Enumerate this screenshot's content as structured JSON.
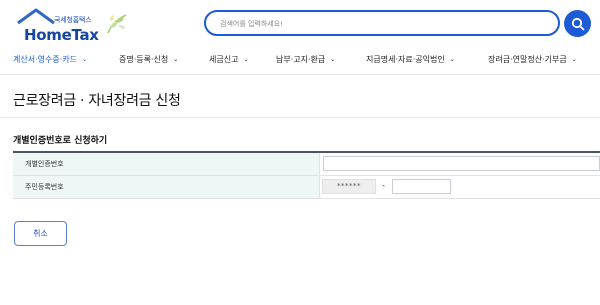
{
  "header": {
    "logo_sub": "국세청홈택스",
    "logo_main": "HomeTax",
    "search_placeholder": "검색어를 입력하세요!"
  },
  "nav": {
    "items": [
      {
        "label": "계산서·영수증·카드",
        "active": true
      },
      {
        "label": "증명·등록·신청",
        "active": false
      },
      {
        "label": "세금신고",
        "active": false
      },
      {
        "label": "납부·고지·환급",
        "active": false
      },
      {
        "label": "지급명세·자료·공익법인",
        "active": false
      },
      {
        "label": "장려금·연말정산·기부금",
        "active": false
      }
    ]
  },
  "page": {
    "title": "근로장려금 · 자녀장려금 신청",
    "section_title": "개별인증번호로 신청하기"
  },
  "form": {
    "cert_label": "개별인증번호",
    "cert_value": "",
    "rrn_label": "주민등록번호",
    "rrn_masked": "******",
    "rrn_dash": "-",
    "rrn_back_value": ""
  },
  "buttons": {
    "cancel": "취소"
  },
  "colors": {
    "accent": "#1c5bd4",
    "label_bg": "#eef6f6"
  }
}
